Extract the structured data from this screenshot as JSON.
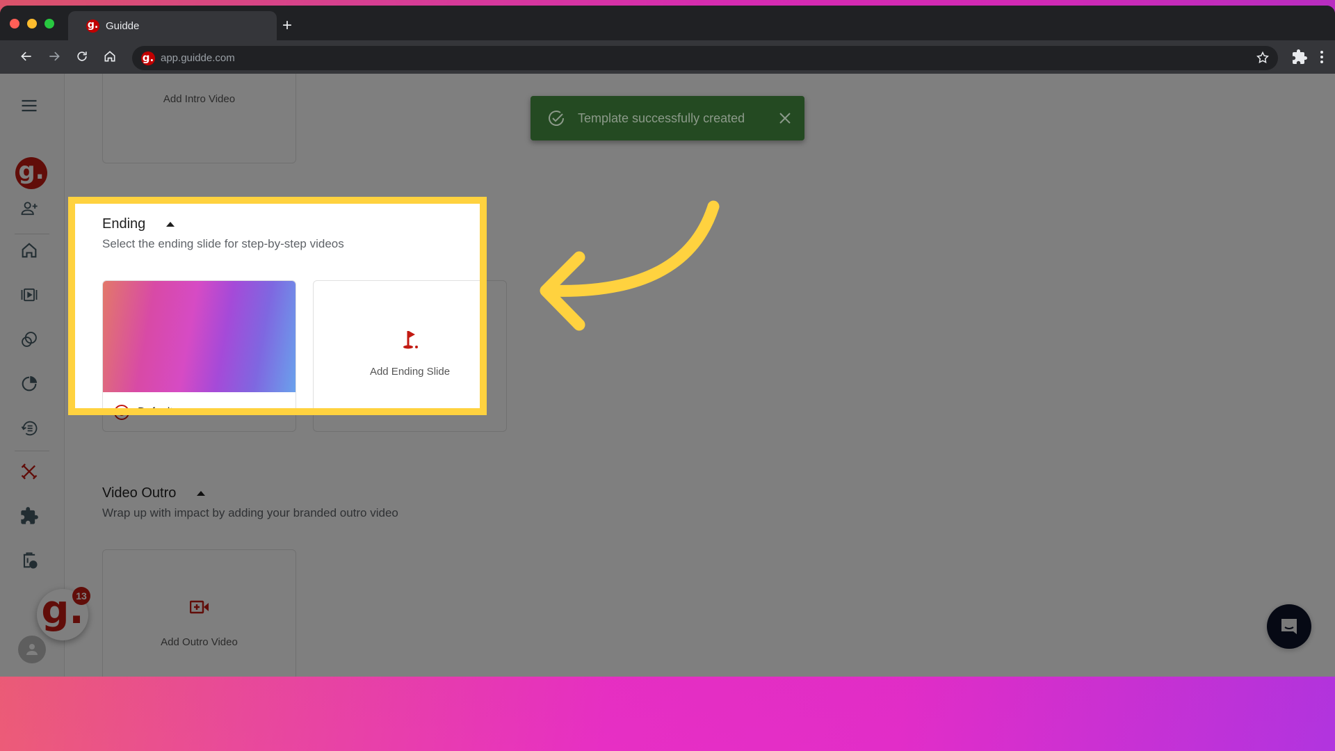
{
  "browser": {
    "tab_title": "Guidde",
    "favicon_letter": "g.",
    "new_tab_label": "+",
    "url": "app.guidde.com"
  },
  "sidebar": {
    "logo_letter": "g.",
    "items": [
      {
        "name": "menu",
        "icon": "hamburger-icon"
      },
      {
        "name": "workspace-logo",
        "icon": "guidde-logo-icon"
      },
      {
        "name": "invite-user",
        "icon": "add-user-icon"
      },
      {
        "name": "home",
        "icon": "home-icon"
      },
      {
        "name": "videos",
        "icon": "video-library-icon"
      },
      {
        "name": "spaces",
        "icon": "overlapping-circles-icon"
      },
      {
        "name": "analytics",
        "icon": "pie-chart-icon"
      },
      {
        "name": "history",
        "icon": "history-list-icon"
      },
      {
        "name": "brand-kit",
        "icon": "design-tools-icon",
        "active": true
      },
      {
        "name": "integrations",
        "icon": "puzzle-icon"
      },
      {
        "name": "trash",
        "icon": "trash-clock-icon"
      }
    ],
    "fab_letter": "g.",
    "fab_badge_count": "13"
  },
  "main": {
    "intro": {
      "card_label": "Add Intro Video"
    },
    "ending": {
      "title": "Ending",
      "subtitle": "Select the ending slide for step-by-step videos",
      "default_option_label": "Default",
      "default_selected": true,
      "add_card_label": "Add Ending Slide"
    },
    "outro": {
      "title": "Video Outro",
      "subtitle": "Wrap up with impact by adding your branded outro video",
      "card_label": "Add Outro Video"
    }
  },
  "toast": {
    "message": "Template successfully created",
    "status": "success"
  },
  "colors": {
    "brand_red": "#c21a12",
    "highlight_yellow": "#ffd23f",
    "toast_green": "#244a22",
    "chat_navy": "#0c1229"
  }
}
